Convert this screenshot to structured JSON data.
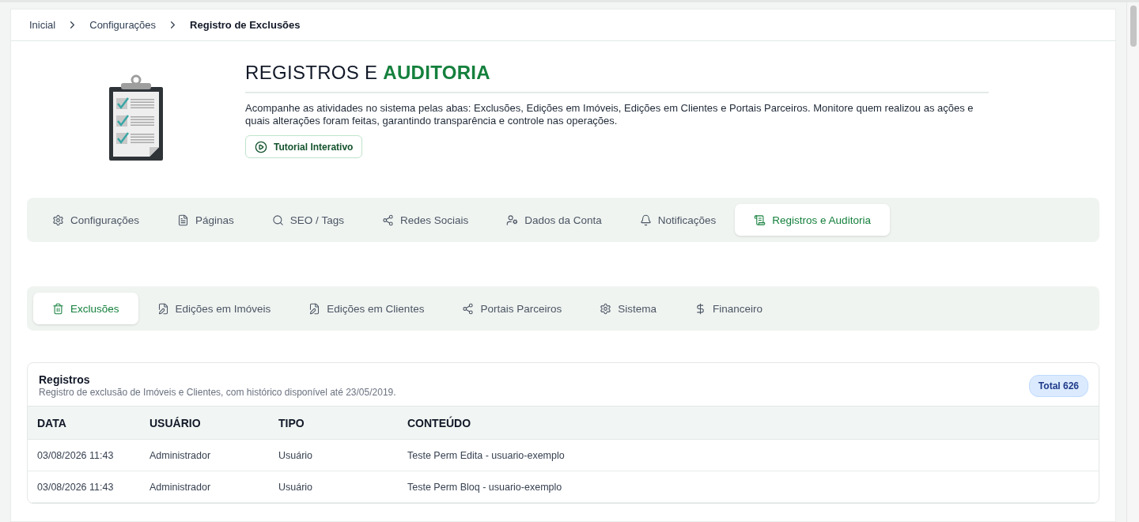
{
  "breadcrumb": [
    {
      "label": "Inicial",
      "current": false
    },
    {
      "label": "Configurações",
      "current": false
    },
    {
      "label": "Registro de Exclusões",
      "current": true
    }
  ],
  "header": {
    "title": "REGISTROS E",
    "title_highlight": "AUDITORIA",
    "description": "Acompanhe as atividades no sistema pelas abas: Exclusões, Edições em Imóveis, Edições em Clientes e Portais Parceiros. Monitore quem realizou as ações e quais alterações foram feitas, garantindo transparência e controle nas operações.",
    "tutorial_button": "Tutorial Interativo"
  },
  "main_tabs": [
    {
      "label": "Configurações",
      "selected": false
    },
    {
      "label": "Páginas",
      "selected": false
    },
    {
      "label": "SEO / Tags",
      "selected": false
    },
    {
      "label": "Redes Sociais",
      "selected": false
    },
    {
      "label": "Dados da Conta",
      "selected": false
    },
    {
      "label": "Notificações",
      "selected": false
    },
    {
      "label": "Registros e Auditoria",
      "selected": true
    }
  ],
  "sub_tabs": [
    {
      "label": "Exclusões",
      "selected": true
    },
    {
      "label": "Edições em Imóveis",
      "selected": false
    },
    {
      "label": "Edições em Clientes",
      "selected": false
    },
    {
      "label": "Portais Parceiros",
      "selected": false
    },
    {
      "label": "Sistema",
      "selected": false
    },
    {
      "label": "Financeiro",
      "selected": false
    }
  ],
  "records": {
    "title": "Registros",
    "subtitle": "Registro de exclusão de Imóveis e Clientes, com histórico disponível até 23/05/2019.",
    "total": "Total 626",
    "columns": [
      "DATA",
      "USUÁRIO",
      "TIPO",
      "CONTEÚDO"
    ],
    "rows": [
      [
        "03/08/2026 11:43",
        "Administrador",
        "Usuário",
        "Teste Perm Edita - usuario-exemplo"
      ],
      [
        "03/08/2026 11:43",
        "Administrador",
        "Usuário",
        "Teste Perm Bloq - usuario-exemplo"
      ]
    ]
  }
}
